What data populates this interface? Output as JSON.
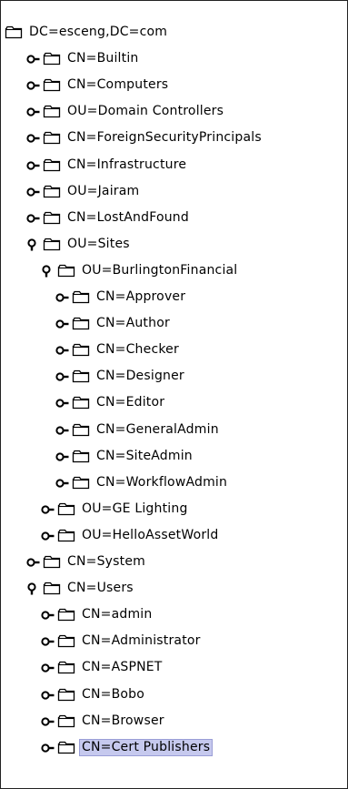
{
  "tree": {
    "nodes": [
      {
        "label": "DC=esceng,DC=com",
        "depth": 0,
        "handle": "none"
      },
      {
        "label": "CN=Builtin",
        "depth": 1,
        "handle": "collapsed"
      },
      {
        "label": "CN=Computers",
        "depth": 1,
        "handle": "collapsed"
      },
      {
        "label": "OU=Domain Controllers",
        "depth": 1,
        "handle": "collapsed"
      },
      {
        "label": "CN=ForeignSecurityPrincipals",
        "depth": 1,
        "handle": "collapsed"
      },
      {
        "label": "CN=Infrastructure",
        "depth": 1,
        "handle": "collapsed"
      },
      {
        "label": "OU=Jairam",
        "depth": 1,
        "handle": "collapsed"
      },
      {
        "label": "CN=LostAndFound",
        "depth": 1,
        "handle": "collapsed"
      },
      {
        "label": "OU=Sites",
        "depth": 1,
        "handle": "expanded"
      },
      {
        "label": "OU=BurlingtonFinancial",
        "depth": 2,
        "handle": "expanded"
      },
      {
        "label": "CN=Approver",
        "depth": 3,
        "handle": "collapsed"
      },
      {
        "label": "CN=Author",
        "depth": 3,
        "handle": "collapsed"
      },
      {
        "label": "CN=Checker",
        "depth": 3,
        "handle": "collapsed"
      },
      {
        "label": "CN=Designer",
        "depth": 3,
        "handle": "collapsed"
      },
      {
        "label": "CN=Editor",
        "depth": 3,
        "handle": "collapsed"
      },
      {
        "label": "CN=GeneralAdmin",
        "depth": 3,
        "handle": "collapsed"
      },
      {
        "label": "CN=SiteAdmin",
        "depth": 3,
        "handle": "collapsed"
      },
      {
        "label": "CN=WorkflowAdmin",
        "depth": 3,
        "handle": "collapsed"
      },
      {
        "label": "OU=GE Lighting",
        "depth": 2,
        "handle": "collapsed"
      },
      {
        "label": "OU=HelloAssetWorld",
        "depth": 2,
        "handle": "collapsed"
      },
      {
        "label": "CN=System",
        "depth": 1,
        "handle": "collapsed"
      },
      {
        "label": "CN=Users",
        "depth": 1,
        "handle": "expanded"
      },
      {
        "label": "CN=admin",
        "depth": 2,
        "handle": "collapsed"
      },
      {
        "label": "CN=Administrator",
        "depth": 2,
        "handle": "collapsed"
      },
      {
        "label": "CN=ASPNET",
        "depth": 2,
        "handle": "collapsed"
      },
      {
        "label": "CN=Bobo",
        "depth": 2,
        "handle": "collapsed"
      },
      {
        "label": "CN=Browser",
        "depth": 2,
        "handle": "collapsed"
      },
      {
        "label": "CN=Cert Publishers",
        "depth": 2,
        "handle": "collapsed",
        "selected": true
      }
    ]
  },
  "icons": {
    "folder": "folder-icon",
    "collapsed_handle": "tree-collapsed-handle-icon",
    "expanded_handle": "tree-expanded-handle-icon"
  },
  "colors": {
    "selection_background": "#c6c9ee",
    "selection_border": "#9a9ed6",
    "folder_fill": "#ffffff",
    "folder_outline": "#000000"
  }
}
